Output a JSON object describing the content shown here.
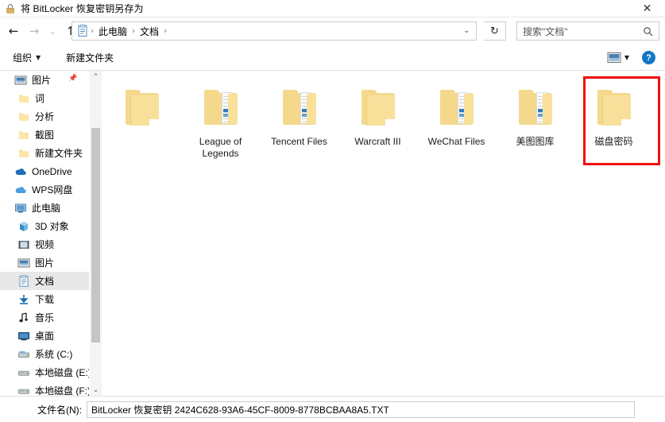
{
  "window": {
    "title": "将 BitLocker 恢复密钥另存为",
    "title_icon": "bitlocker-icon",
    "close_label": "✕"
  },
  "nav": {
    "back": "←",
    "forward": "→",
    "history": "⌄",
    "up": "↑",
    "refresh": "↻",
    "address_icon": "documents-folder-icon",
    "breadcrumbs": [
      "此电脑",
      "文档"
    ],
    "separator": "›",
    "dropdown": "⌄"
  },
  "search": {
    "placeholder": "搜索\"文档\"",
    "icon": "search-icon"
  },
  "toolbar": {
    "organize_label": "组织",
    "organize_caret": "▼",
    "new_folder_label": "新建文件夹",
    "view_icon": "view-mode-icon",
    "view_caret": "▼",
    "help_label": "?"
  },
  "sidebar": {
    "scroll_up": "⌃",
    "scroll_down": "⌄",
    "pin_icon": "pin-icon",
    "items": [
      {
        "label": "图片",
        "icon": "pictures-icon",
        "indent": 1,
        "pinned": true,
        "selected": false
      },
      {
        "label": "词",
        "icon": "folder-icon",
        "indent": 2,
        "pinned": false,
        "selected": false
      },
      {
        "label": "分析",
        "icon": "folder-icon",
        "indent": 2,
        "pinned": false,
        "selected": false
      },
      {
        "label": "截图",
        "icon": "folder-icon",
        "indent": 2,
        "pinned": false,
        "selected": false
      },
      {
        "label": "新建文件夹",
        "icon": "folder-icon",
        "indent": 2,
        "pinned": false,
        "selected": false
      },
      {
        "label": "OneDrive",
        "icon": "onedrive-cloud-icon",
        "indent": 1,
        "pinned": false,
        "selected": false
      },
      {
        "label": "WPS网盘",
        "icon": "wps-cloud-icon",
        "indent": 1,
        "pinned": false,
        "selected": false
      },
      {
        "label": "此电脑",
        "icon": "this-pc-icon",
        "indent": 1,
        "pinned": false,
        "selected": false
      },
      {
        "label": "3D 对象",
        "icon": "3d-objects-icon",
        "indent": 2,
        "pinned": false,
        "selected": false
      },
      {
        "label": "视频",
        "icon": "videos-icon",
        "indent": 2,
        "pinned": false,
        "selected": false
      },
      {
        "label": "图片",
        "icon": "pictures-icon",
        "indent": 2,
        "pinned": false,
        "selected": false
      },
      {
        "label": "文档",
        "icon": "documents-icon",
        "indent": 2,
        "pinned": false,
        "selected": true
      },
      {
        "label": "下载",
        "icon": "downloads-icon",
        "indent": 2,
        "pinned": false,
        "selected": false
      },
      {
        "label": "音乐",
        "icon": "music-icon",
        "indent": 2,
        "pinned": false,
        "selected": false
      },
      {
        "label": "桌面",
        "icon": "desktop-icon",
        "indent": 2,
        "pinned": false,
        "selected": false
      },
      {
        "label": "系统 (C:)",
        "icon": "system-drive-icon",
        "indent": 2,
        "pinned": false,
        "selected": false
      },
      {
        "label": "本地磁盘 (E:)",
        "icon": "local-drive-icon",
        "indent": 2,
        "pinned": false,
        "selected": false
      },
      {
        "label": "本地磁盘 (F:)",
        "icon": "local-drive-icon",
        "indent": 2,
        "pinned": false,
        "selected": false
      }
    ]
  },
  "files": [
    {
      "label": "",
      "type": "folder-empty",
      "highlighted": false
    },
    {
      "label": "League of Legends",
      "type": "folder-docs",
      "highlighted": false
    },
    {
      "label": "Tencent Files",
      "type": "folder-docs",
      "highlighted": false
    },
    {
      "label": "Warcraft III",
      "type": "folder-empty",
      "highlighted": false
    },
    {
      "label": "WeChat Files",
      "type": "folder-docs",
      "highlighted": false
    },
    {
      "label": "美图图库",
      "type": "folder-docs",
      "highlighted": false
    },
    {
      "label": "磁盘密码",
      "type": "folder-empty",
      "highlighted": true
    }
  ],
  "annotation": {
    "color": "#ee1111",
    "target": "磁盘密码"
  },
  "bottom": {
    "filename_label": "文件名(N):",
    "filename_value": "BitLocker 恢复密钥 2424C628-93A6-45CF-8009-8778BCBAA8A5.TXT"
  }
}
